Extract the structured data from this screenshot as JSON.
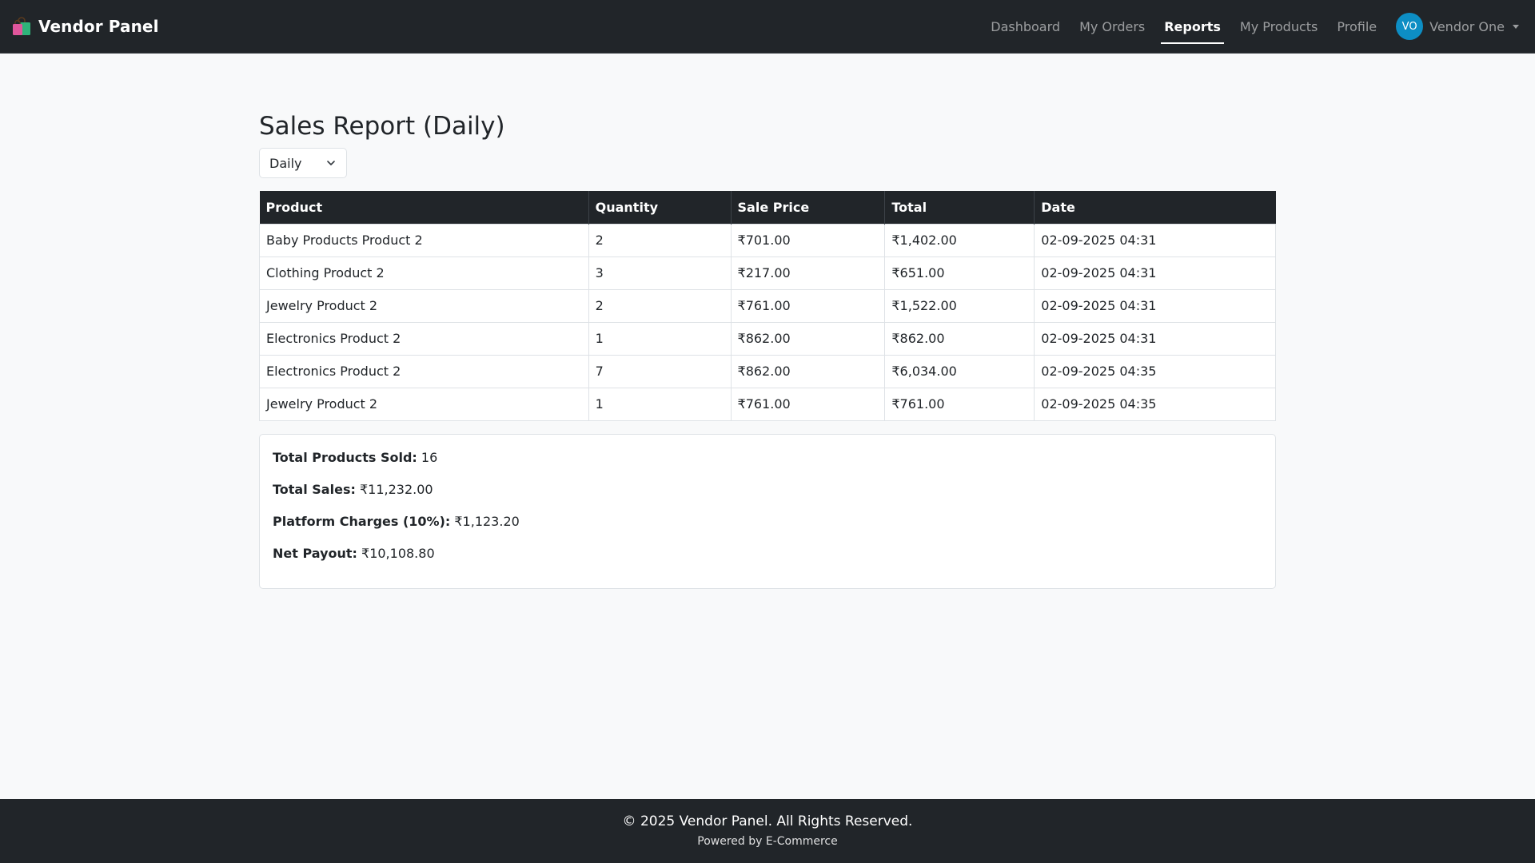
{
  "brand": {
    "title": "Vendor Panel",
    "icon": "shopping-bags-icon"
  },
  "nav": {
    "items": [
      {
        "label": "Dashboard"
      },
      {
        "label": "My Orders"
      },
      {
        "label": "Reports"
      },
      {
        "label": "My Products"
      },
      {
        "label": "Profile"
      }
    ],
    "active": "Reports",
    "user": {
      "initials": "VO",
      "name": "Vendor One"
    }
  },
  "page": {
    "title": "Sales Report (Daily)",
    "period_select": {
      "value": "Daily"
    }
  },
  "table": {
    "headers": [
      "Product",
      "Quantity",
      "Sale Price",
      "Total",
      "Date"
    ],
    "rows": [
      [
        "Baby Products Product 2",
        "2",
        "₹701.00",
        "₹1,402.00",
        "02-09-2025 04:31"
      ],
      [
        "Clothing Product 2",
        "3",
        "₹217.00",
        "₹651.00",
        "02-09-2025 04:31"
      ],
      [
        "Jewelry Product 2",
        "2",
        "₹761.00",
        "₹1,522.00",
        "02-09-2025 04:31"
      ],
      [
        "Electronics Product 2",
        "1",
        "₹862.00",
        "₹862.00",
        "02-09-2025 04:31"
      ],
      [
        "Electronics Product 2",
        "7",
        "₹862.00",
        "₹6,034.00",
        "02-09-2025 04:35"
      ],
      [
        "Jewelry Product 2",
        "1",
        "₹761.00",
        "₹761.00",
        "02-09-2025 04:35"
      ]
    ]
  },
  "summary": {
    "total_products_label": "Total Products Sold:",
    "total_products_value": "16",
    "total_sales_label": "Total Sales:",
    "total_sales_value": "₹11,232.00",
    "platform_label": "Platform Charges (10%):",
    "platform_value": "₹1,123.20",
    "net_label": "Net Payout:",
    "net_value": "₹10,108.80"
  },
  "footer": {
    "copyright": "© 2025 Vendor Panel. All Rights Reserved.",
    "powered": "Powered by E-Commerce"
  },
  "colors": {
    "navbar": "#212529",
    "avatar": "#0d8ec4",
    "background": "#f8f9fa"
  }
}
